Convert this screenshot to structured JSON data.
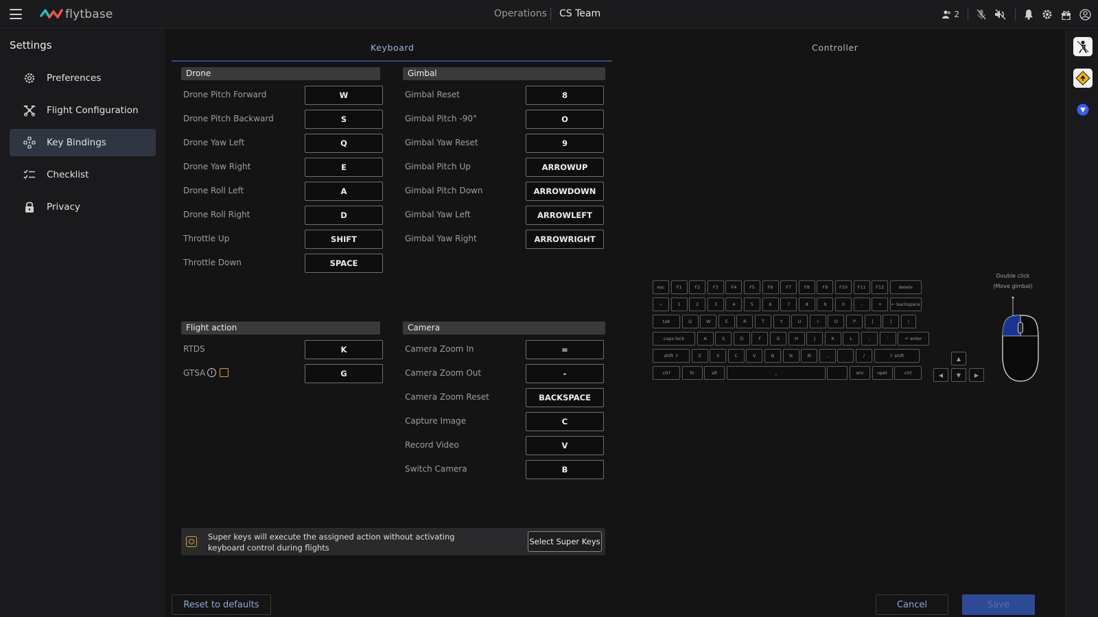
{
  "topbar": {
    "logo_text": "flytbase",
    "breadcrumb_ops": "Operations",
    "breadcrumb_team": "CS Team",
    "user_count": "2"
  },
  "sidebar": {
    "title": "Settings",
    "items": [
      {
        "label": "Preferences",
        "icon": "gear-icon"
      },
      {
        "label": "Flight Configuration",
        "icon": "drone-icon"
      },
      {
        "label": "Key Bindings",
        "icon": "key-bindings-icon"
      },
      {
        "label": "Checklist",
        "icon": "checklist-icon"
      },
      {
        "label": "Privacy",
        "icon": "lock-icon"
      }
    ],
    "active": "Key Bindings"
  },
  "tabs": {
    "keyboard": "Keyboard",
    "controller": "Controller",
    "active": "Keyboard"
  },
  "drone": {
    "title": "Drone",
    "rows": [
      {
        "label": "Drone Pitch Forward",
        "key": "W"
      },
      {
        "label": "Drone Pitch Backward",
        "key": "S"
      },
      {
        "label": "Drone Yaw Left",
        "key": "Q"
      },
      {
        "label": "Drone Yaw Right",
        "key": "E"
      },
      {
        "label": "Drone Roll Left",
        "key": "A"
      },
      {
        "label": "Drone Roll Right",
        "key": "D"
      },
      {
        "label": "Throttle Up",
        "key": "SHIFT"
      },
      {
        "label": "Throttle Down",
        "key": "SPACE"
      }
    ]
  },
  "gimbal": {
    "title": "Gimbal",
    "rows": [
      {
        "label": "Gimbal Reset",
        "key": "8"
      },
      {
        "label": "Gimbal Pitch -90°",
        "key": "O"
      },
      {
        "label": "Gimbal Yaw Reset",
        "key": "9"
      },
      {
        "label": "Gimbal Pitch Up",
        "key": "ARROWUP"
      },
      {
        "label": "Gimbal Pitch Down",
        "key": "ARROWDOWN"
      },
      {
        "label": "Gimbal Yaw Left",
        "key": "ARROWLEFT"
      },
      {
        "label": "Gimbal Yaw Right",
        "key": "ARROWRIGHT"
      }
    ]
  },
  "flight_action": {
    "title": "Flight action",
    "rows": [
      {
        "label": "RTDS",
        "key": "K"
      },
      {
        "label": "GTSA",
        "key": "G"
      }
    ]
  },
  "camera": {
    "title": "Camera",
    "rows": [
      {
        "label": "Camera Zoom In",
        "key": "="
      },
      {
        "label": "Camera Zoom Out",
        "key": "-"
      },
      {
        "label": "Camera Zoom Reset",
        "key": "BACKSPACE"
      },
      {
        "label": "Capture Image",
        "key": "C"
      },
      {
        "label": "Record Video",
        "key": "V"
      },
      {
        "label": "Switch Camera",
        "key": "B"
      }
    ]
  },
  "super_keys": {
    "message": "Super keys will execute the assigned action without activating keyboard control during flights",
    "button": "Select Super Keys"
  },
  "footer": {
    "reset": "Reset to defaults",
    "cancel": "Cancel",
    "save": "Save"
  },
  "keyboard_diagram": {
    "rows": [
      [
        "esc",
        "F1",
        "F2",
        "F3",
        "F4",
        "F5",
        "F6",
        "F7",
        "F8",
        "F9",
        "F10",
        "F11",
        "F12",
        "delete"
      ],
      [
        "~",
        "1",
        "2",
        "3",
        "4",
        "5",
        "6",
        "7",
        "8",
        "9",
        "0",
        "-",
        "+",
        "← backspace"
      ],
      [
        "tab",
        "Q",
        "W",
        "E",
        "R",
        "T",
        "Y",
        "U",
        "I",
        "O",
        "P",
        "[",
        "]",
        "\\"
      ],
      [
        "caps lock",
        "A",
        "S",
        "D",
        "F",
        "G",
        "H",
        "J",
        "K",
        "L",
        ";",
        "'",
        "↵ enter"
      ],
      [
        "shift ⇧",
        "Z",
        "X",
        "C",
        "V",
        "B",
        "N",
        "M",
        ",",
        ".",
        "/",
        "⇧ shift"
      ],
      [
        "ctrl",
        "fn",
        "alt",
        "⎵",
        "",
        "win",
        "opet",
        "ctrl"
      ]
    ],
    "arrows": [
      "▲",
      "◀",
      "▼",
      "▶"
    ],
    "mouse_label_1": "Double click",
    "mouse_label_2": "(Move gimbal)"
  }
}
